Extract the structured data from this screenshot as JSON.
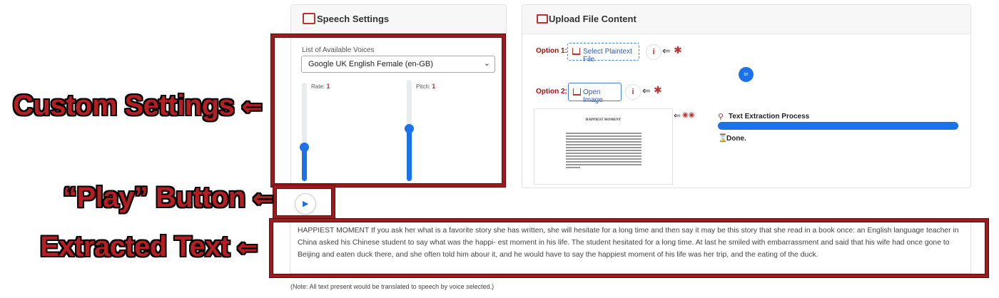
{
  "speech_settings": {
    "title": "Speech Settings",
    "voice_label": "List of Available Voices",
    "voice_selected": "Google UK English Female (en-GB)",
    "rate_label": "Rate:",
    "rate_value": "1",
    "rate_level": 0.35,
    "pitch_label": "Pitch:",
    "pitch_value": "1",
    "pitch_level": 0.52
  },
  "upload": {
    "title": "Upload File Content",
    "option1_label": "Option 1:",
    "option1_button": "Select Plaintext File",
    "option2_label": "Option 2:",
    "option2_button": "Open Image",
    "or_label": "or",
    "info_label": "i",
    "doc_preview_title": "HAPPIEST MOMENT",
    "process_title": "Text Extraction Process",
    "progress": 1.0,
    "status": "Done."
  },
  "play_button": {
    "label": "▶"
  },
  "extracted_text": "HAPPIEST MOMENT If you ask her what is a favorite story she has written, she will hesitate for a long time and then say it may be this story that she read in a book once: an English language teacher in China asked his Chinese student to say what was the happi- est moment in his life. The student hesitated for a long time. At last he smiled with embarrassment and said that his wife had once gone to Beijing and eaten duck there, and she often told him abour it, and he would have to say the happiest moment of his life was her trip, and the eating of the duck.",
  "note": "(Note: All text present would be translated to speech by voice selected.)",
  "callouts": {
    "custom_settings": "Custom Settings",
    "play_button": "“Play” Button",
    "extracted_text": "Extracted Text",
    "arrow": "⇐"
  },
  "colors": {
    "accent": "#1a73e8",
    "callout_red": "#b51e23",
    "box_red": "#9b1b1e"
  }
}
